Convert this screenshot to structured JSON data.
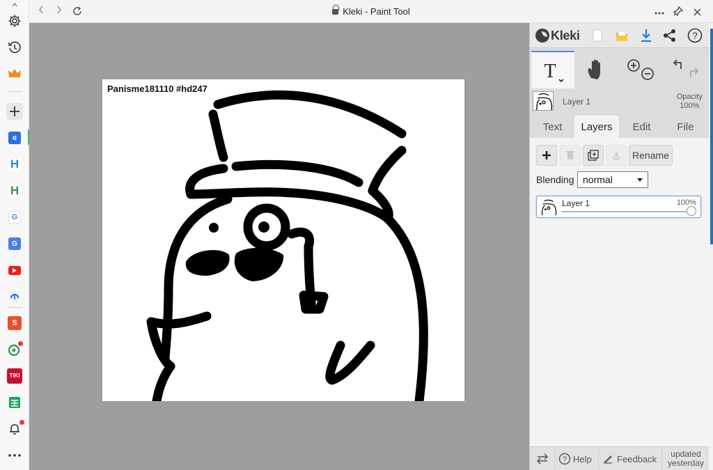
{
  "window": {
    "title": "Kleki - Paint Tool",
    "nav_back_icon": "back-arrow-icon",
    "nav_forward_icon": "forward-arrow-icon",
    "reload_icon": "reload-icon",
    "lock_icon": "lock-icon",
    "more_icon": "more-horizontal-icon",
    "pin_icon": "pin-icon",
    "close_icon": "close-icon"
  },
  "browser_sidebar": {
    "items": [
      "settings",
      "history",
      "crown",
      "add",
      "kleki",
      "app-h-1",
      "app-h-2",
      "google",
      "google-translate",
      "youtube",
      "edge-drop",
      "shopee",
      "green-app",
      "tiki",
      "sheets",
      "notifications",
      "more"
    ]
  },
  "canvas": {
    "caption": "Panisme181110 #hd247"
  },
  "panel": {
    "brand": "Kleki",
    "accent": "#4b8bd6",
    "layer_name": "Layer 1",
    "opacity_label": "Opacity",
    "opacity_value": "100%",
    "tabs": [
      "Text",
      "Layers",
      "Edit",
      "File"
    ],
    "active_tab": "Layers",
    "layer_buttons": {
      "rename": "Rename"
    },
    "blending": {
      "label": "Blending",
      "value": "normal"
    },
    "layer_list": [
      {
        "name": "Layer 1",
        "opacity": "100%",
        "opacity_level": 1.0
      }
    ],
    "footer": {
      "help": "Help",
      "feedback": "Feedback",
      "updated": "updated\nyesterday"
    }
  }
}
